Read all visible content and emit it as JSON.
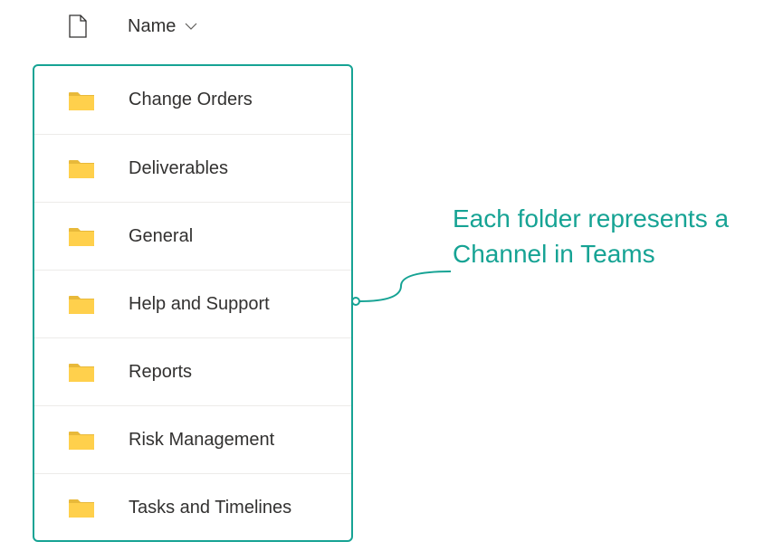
{
  "header": {
    "name_column_label": "Name"
  },
  "folders": [
    {
      "name": "Change Orders"
    },
    {
      "name": "Deliverables"
    },
    {
      "name": "General"
    },
    {
      "name": "Help and Support"
    },
    {
      "name": "Reports"
    },
    {
      "name": "Risk Management"
    },
    {
      "name": "Tasks and Timelines"
    }
  ],
  "annotation": {
    "text": "Each folder represents a Channel in Teams"
  },
  "colors": {
    "accent": "#16a394",
    "folder_fill": "#ffd04c",
    "folder_tab": "#e8b93a",
    "text": "#323130"
  }
}
